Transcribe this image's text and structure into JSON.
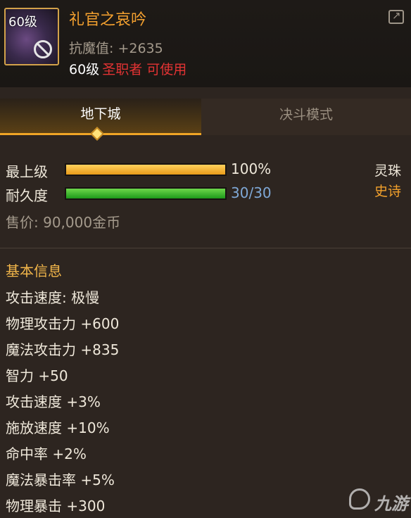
{
  "item": {
    "level_badge": "60级",
    "name": "礼官之哀吟",
    "resist_label": "抗魔值: ",
    "resist_value": "+2635",
    "req_level": "60级",
    "req_class": "圣职者 可使用"
  },
  "tabs": [
    {
      "label": "地下城",
      "active": true
    },
    {
      "label": "决斗模式",
      "active": false
    }
  ],
  "stats_bars": [
    {
      "label": "最上级",
      "value_text": "100%",
      "fraction": 1.0,
      "value_color": "#efe8da"
    },
    {
      "label": "耐久度",
      "value_text": "30/30",
      "fraction": 1.0,
      "value_color": "#7fa8d6"
    }
  ],
  "price": "售价: 90,000金币",
  "orb_label": "灵珠",
  "rarity": "史诗",
  "basic_info": {
    "title": "基本信息",
    "lines": [
      "攻击速度: 极慢",
      "物理攻击力 +600",
      "魔法攻击力 +835",
      "智力 +50",
      "攻击速度 +3%",
      "施放速度 +10%",
      "命中率 +2%",
      "魔法暴击率 +5%",
      "物理暴击 +300"
    ]
  },
  "watermark": {
    "text": "九游"
  },
  "icons": [
    "forbidden-icon",
    "share-icon",
    "tab-indicator-icon",
    "jiuyou-logo-icon"
  ],
  "colors": {
    "name": "#f3a02f",
    "class_req": "#e23333",
    "rarity": "#f2a12c",
    "section_title": "#f2b64a",
    "tab_active_line": "#f0a526"
  }
}
